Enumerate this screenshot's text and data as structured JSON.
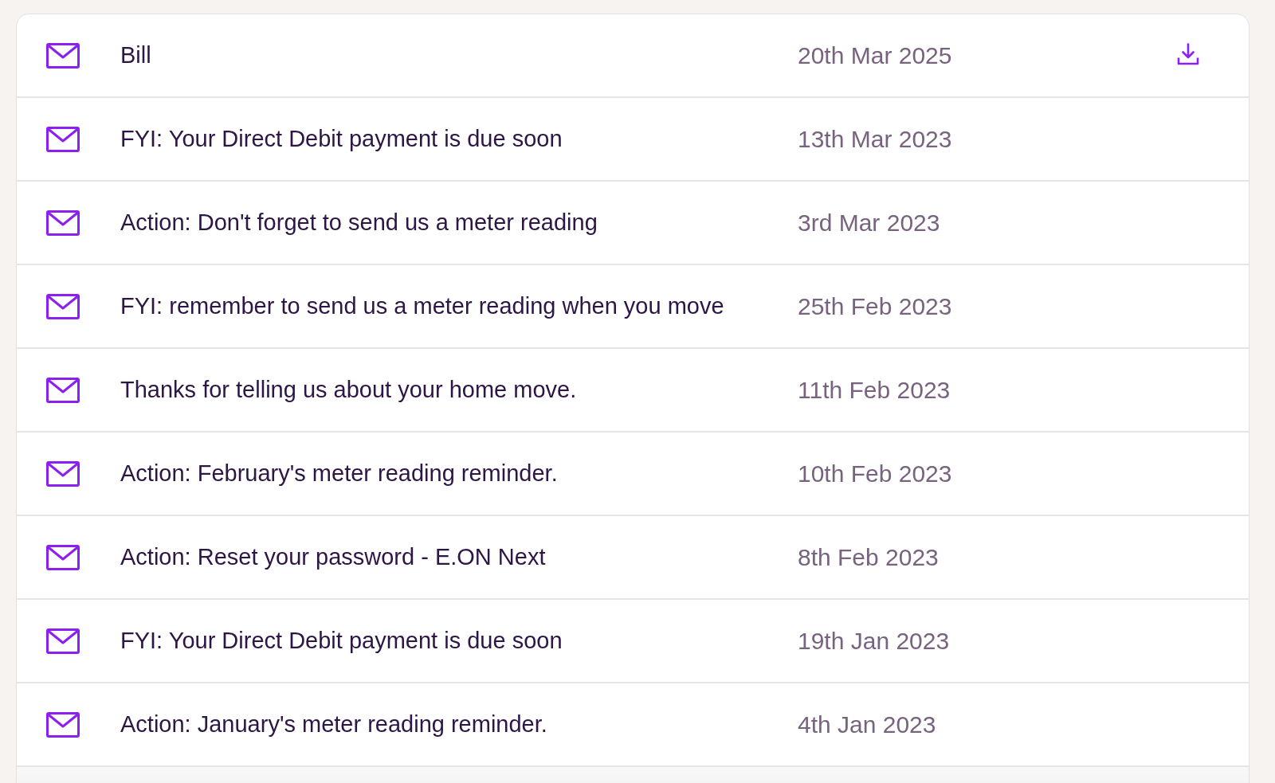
{
  "messages": [
    {
      "subject": "Bill",
      "date": "20th Mar 2025",
      "download": true
    },
    {
      "subject": "FYI: Your Direct Debit payment is due soon",
      "date": "13th Mar 2023",
      "download": false
    },
    {
      "subject": "Action: Don't forget to send us a meter reading",
      "date": "3rd Mar 2023",
      "download": false
    },
    {
      "subject": "FYI: remember to send us a meter reading when you move",
      "date": "25th Feb 2023",
      "download": false
    },
    {
      "subject": "Thanks for telling us about your home move.",
      "date": "11th Feb 2023",
      "download": false
    },
    {
      "subject": "Action: February's meter reading reminder.",
      "date": "10th Feb 2023",
      "download": false
    },
    {
      "subject": "Action: Reset your password - E.ON Next",
      "date": "8th Feb 2023",
      "download": false
    },
    {
      "subject": "FYI: Your Direct Debit payment is due soon",
      "date": "19th Jan 2023",
      "download": false
    },
    {
      "subject": "Action: January's meter reading reminder.",
      "date": "4th Jan 2023",
      "download": false
    }
  ]
}
